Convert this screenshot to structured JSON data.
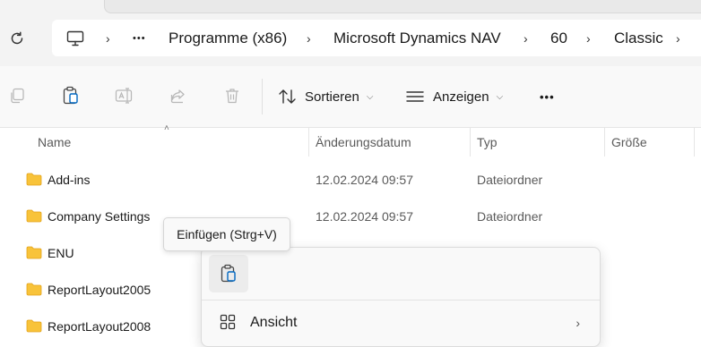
{
  "address": {
    "overflow": "•••",
    "crumbs": [
      "Programme (x86)",
      "Microsoft Dynamics NAV",
      "60",
      "Classic"
    ]
  },
  "toolbar": {
    "sort_label": "Sortieren",
    "view_label": "Anzeigen",
    "more": "•••"
  },
  "columns": {
    "name": "Name",
    "date": "Änderungsdatum",
    "type": "Typ",
    "size": "Größe"
  },
  "files": [
    {
      "name": "Add-ins",
      "date": "12.02.2024 09:57",
      "type": "Dateiordner"
    },
    {
      "name": "Company Settings",
      "date": "12.02.2024 09:57",
      "type": "Dateiordner"
    },
    {
      "name": "ENU",
      "date": "",
      "type": ""
    },
    {
      "name": "ReportLayout2005",
      "date": "",
      "type": ""
    },
    {
      "name": "ReportLayout2008",
      "date": "",
      "type": ""
    }
  ],
  "tooltip": {
    "text": "Einfügen (Strg+V)"
  },
  "context_menu": {
    "items": [
      {
        "label": "Ansicht"
      }
    ]
  },
  "colors": {
    "accent": "#0067c0",
    "folder": "#f8c33a",
    "folder_dark": "#e3a21a"
  }
}
